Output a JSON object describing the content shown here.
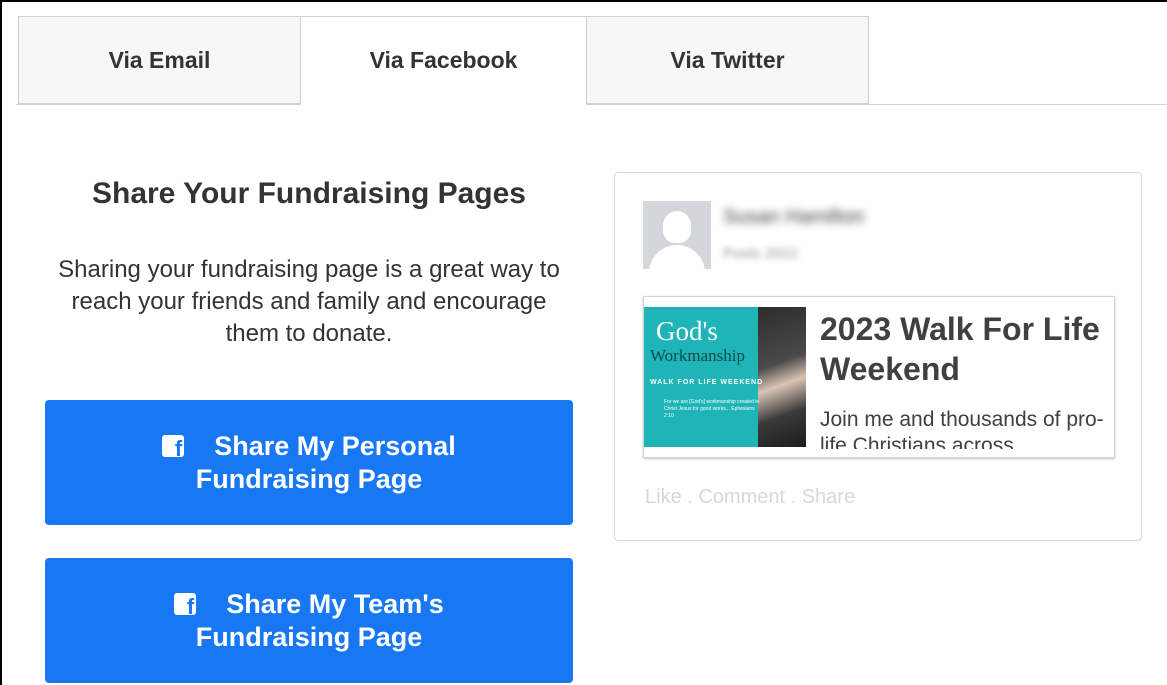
{
  "tabs": [
    {
      "label": "Via Email",
      "active": false
    },
    {
      "label": "Via Facebook",
      "active": true
    },
    {
      "label": "Via Twitter",
      "active": false
    }
  ],
  "share_section": {
    "title": "Share Your Fundraising Pages",
    "description": "Sharing your fundraising page is a great way to reach your friends and family and encourage them to donate.",
    "buttons": [
      {
        "line1": "Share My Personal",
        "line2": "Fundraising Page"
      },
      {
        "line1": "Share My Team's",
        "line2": "Fundraising Page"
      }
    ]
  },
  "preview": {
    "user_name": "Susan Hamilton",
    "post_date": "Posts 2022",
    "thumbnail": {
      "title": "God's",
      "subtitle": "Workmanship",
      "band": "WALK FOR LIFE WEEKEND",
      "verse": "For we are [God's] workmanship created in Christ Jesus for good works... Ephesians 2:10"
    },
    "link_title": "2023 Walk For Life Weekend",
    "link_description": "Join me and thousands of pro-life Christians across",
    "actions": "Like . Comment . Share"
  },
  "colors": {
    "facebook_blue": "#1877f2",
    "thumbnail_teal": "#1fb5b8",
    "tab_inactive_bg": "#f7f7f7"
  },
  "icons": [
    "facebook-icon",
    "avatar-placeholder-icon"
  ]
}
